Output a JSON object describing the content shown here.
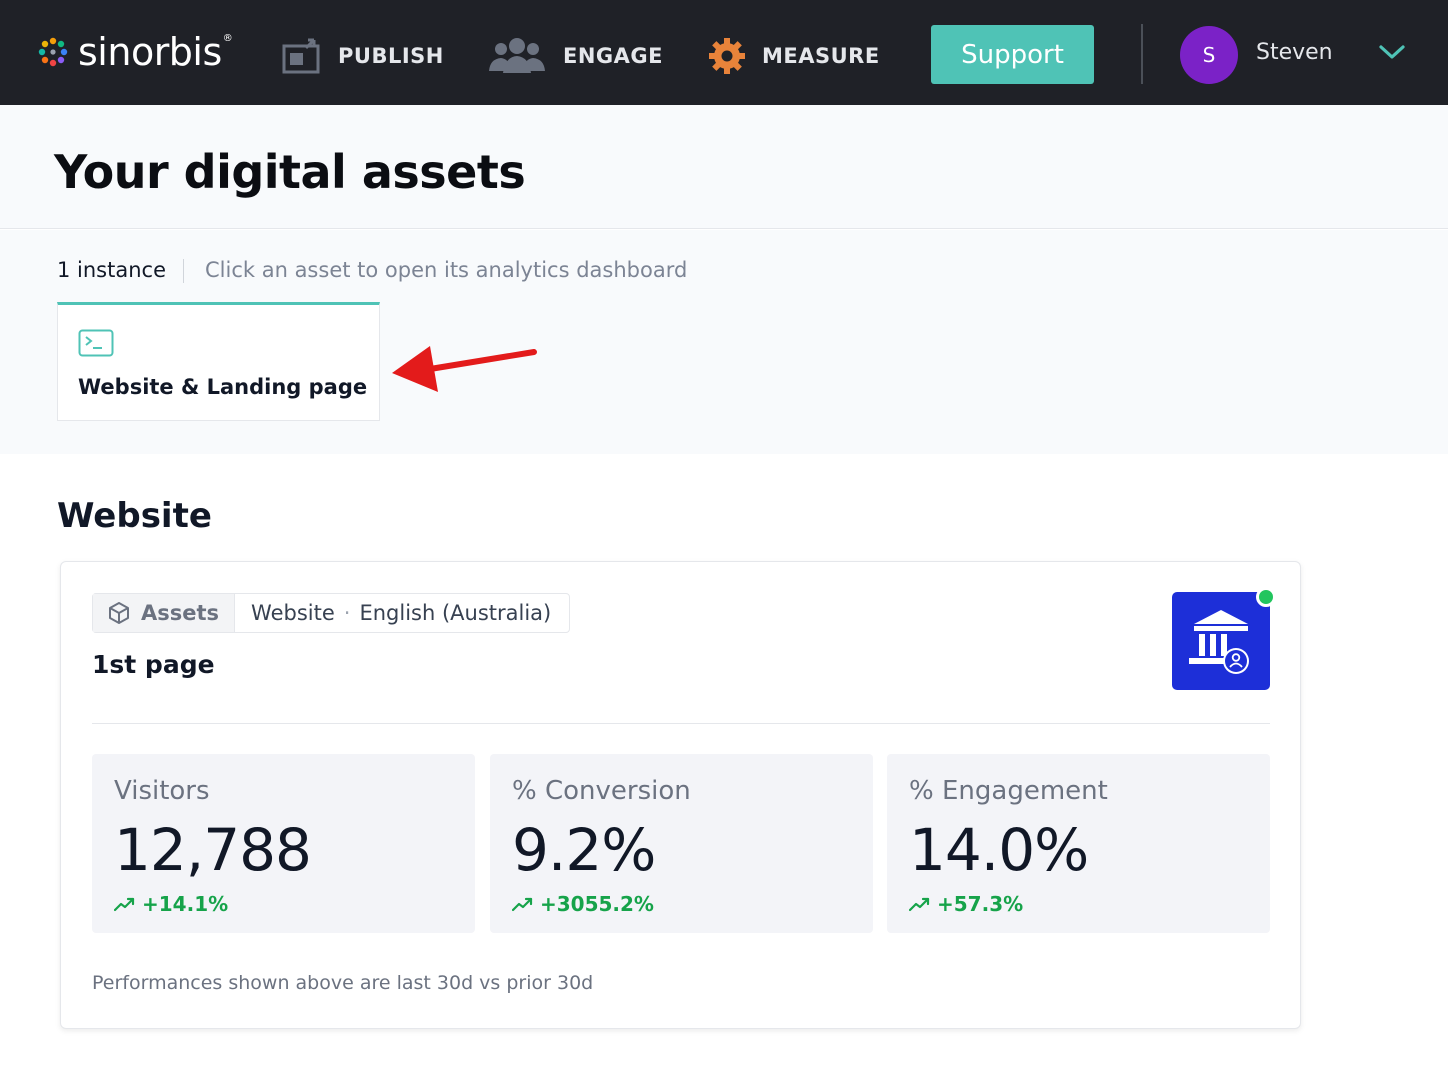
{
  "header": {
    "brand": "sinorbis",
    "brand_mark": "®",
    "nav": [
      {
        "label": "PUBLISH",
        "icon": "publish-icon"
      },
      {
        "label": "ENGAGE",
        "icon": "people-icon"
      },
      {
        "label": "MEASURE",
        "icon": "measure-icon"
      }
    ],
    "support_label": "Support",
    "user": {
      "initial": "S",
      "name": "Steven",
      "avatar_color": "#7b22c7"
    }
  },
  "page": {
    "title": "Your digital assets"
  },
  "instances": {
    "count_label": "1 instance",
    "hint": "Click an asset to open its analytics dashboard",
    "assets": [
      {
        "label": "Website & Landing page",
        "icon": "terminal-icon"
      }
    ]
  },
  "website": {
    "section_title": "Website",
    "crumb": {
      "tag": "Assets",
      "type": "Website",
      "locale": "English (Australia)",
      "separator": "·"
    },
    "page_name": "1st page",
    "status": "online",
    "kpis": [
      {
        "label": "Visitors",
        "value": "12,788",
        "delta": "+14.1%",
        "trend": "up"
      },
      {
        "label": "% Conversion",
        "value": "9.2%",
        "delta": "+3055.2%",
        "trend": "up"
      },
      {
        "label": "% Engagement",
        "value": "14.0%",
        "delta": "+57.3%",
        "trend": "up"
      }
    ],
    "footnote": "Performances shown above are last 30d vs prior 30d"
  },
  "colors": {
    "nav_bg": "#1f2127",
    "accent": "#4fc3b6",
    "avatar": "#7b22c7",
    "positive": "#16a34a",
    "site_logo": "#1d2fd8",
    "online": "#22c55e",
    "annotation_arrow": "#e31b1b"
  }
}
